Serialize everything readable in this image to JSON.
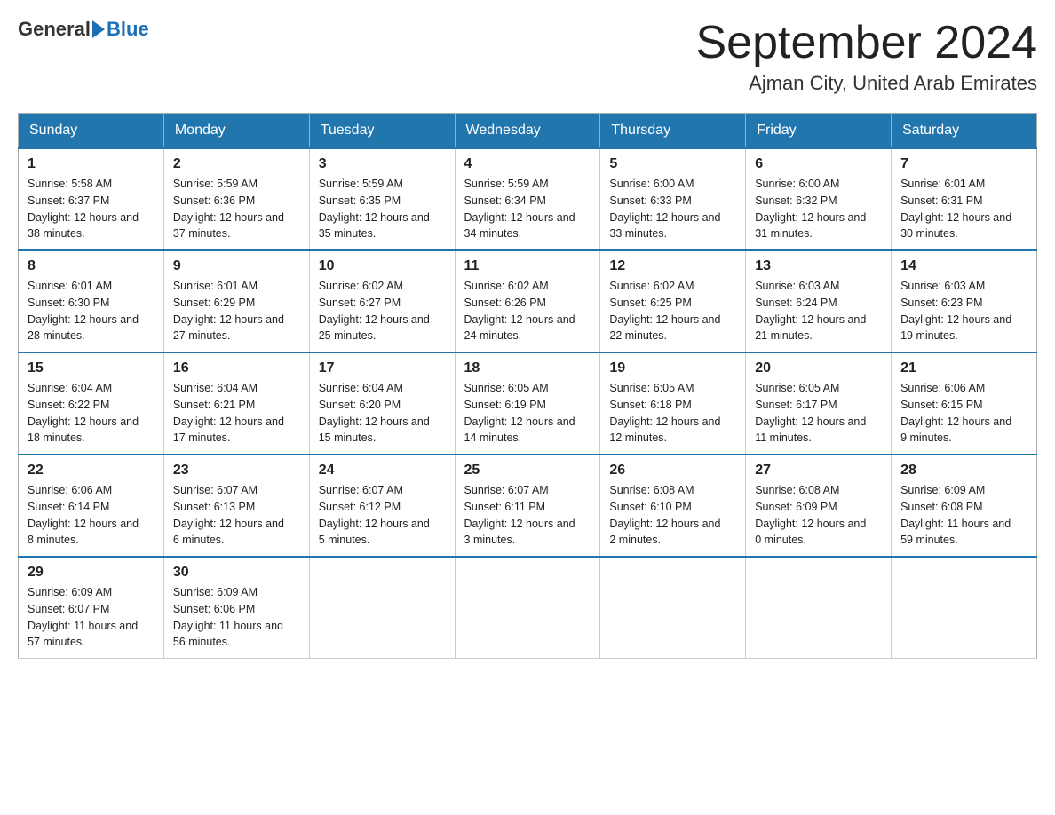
{
  "logo": {
    "general": "General",
    "blue": "Blue"
  },
  "header": {
    "month": "September 2024",
    "location": "Ajman City, United Arab Emirates"
  },
  "days_of_week": [
    "Sunday",
    "Monday",
    "Tuesday",
    "Wednesday",
    "Thursday",
    "Friday",
    "Saturday"
  ],
  "weeks": [
    [
      {
        "day": "1",
        "sunrise": "5:58 AM",
        "sunset": "6:37 PM",
        "daylight": "12 hours and 38 minutes."
      },
      {
        "day": "2",
        "sunrise": "5:59 AM",
        "sunset": "6:36 PM",
        "daylight": "12 hours and 37 minutes."
      },
      {
        "day": "3",
        "sunrise": "5:59 AM",
        "sunset": "6:35 PM",
        "daylight": "12 hours and 35 minutes."
      },
      {
        "day": "4",
        "sunrise": "5:59 AM",
        "sunset": "6:34 PM",
        "daylight": "12 hours and 34 minutes."
      },
      {
        "day": "5",
        "sunrise": "6:00 AM",
        "sunset": "6:33 PM",
        "daylight": "12 hours and 33 minutes."
      },
      {
        "day": "6",
        "sunrise": "6:00 AM",
        "sunset": "6:32 PM",
        "daylight": "12 hours and 31 minutes."
      },
      {
        "day": "7",
        "sunrise": "6:01 AM",
        "sunset": "6:31 PM",
        "daylight": "12 hours and 30 minutes."
      }
    ],
    [
      {
        "day": "8",
        "sunrise": "6:01 AM",
        "sunset": "6:30 PM",
        "daylight": "12 hours and 28 minutes."
      },
      {
        "day": "9",
        "sunrise": "6:01 AM",
        "sunset": "6:29 PM",
        "daylight": "12 hours and 27 minutes."
      },
      {
        "day": "10",
        "sunrise": "6:02 AM",
        "sunset": "6:27 PM",
        "daylight": "12 hours and 25 minutes."
      },
      {
        "day": "11",
        "sunrise": "6:02 AM",
        "sunset": "6:26 PM",
        "daylight": "12 hours and 24 minutes."
      },
      {
        "day": "12",
        "sunrise": "6:02 AM",
        "sunset": "6:25 PM",
        "daylight": "12 hours and 22 minutes."
      },
      {
        "day": "13",
        "sunrise": "6:03 AM",
        "sunset": "6:24 PM",
        "daylight": "12 hours and 21 minutes."
      },
      {
        "day": "14",
        "sunrise": "6:03 AM",
        "sunset": "6:23 PM",
        "daylight": "12 hours and 19 minutes."
      }
    ],
    [
      {
        "day": "15",
        "sunrise": "6:04 AM",
        "sunset": "6:22 PM",
        "daylight": "12 hours and 18 minutes."
      },
      {
        "day": "16",
        "sunrise": "6:04 AM",
        "sunset": "6:21 PM",
        "daylight": "12 hours and 17 minutes."
      },
      {
        "day": "17",
        "sunrise": "6:04 AM",
        "sunset": "6:20 PM",
        "daylight": "12 hours and 15 minutes."
      },
      {
        "day": "18",
        "sunrise": "6:05 AM",
        "sunset": "6:19 PM",
        "daylight": "12 hours and 14 minutes."
      },
      {
        "day": "19",
        "sunrise": "6:05 AM",
        "sunset": "6:18 PM",
        "daylight": "12 hours and 12 minutes."
      },
      {
        "day": "20",
        "sunrise": "6:05 AM",
        "sunset": "6:17 PM",
        "daylight": "12 hours and 11 minutes."
      },
      {
        "day": "21",
        "sunrise": "6:06 AM",
        "sunset": "6:15 PM",
        "daylight": "12 hours and 9 minutes."
      }
    ],
    [
      {
        "day": "22",
        "sunrise": "6:06 AM",
        "sunset": "6:14 PM",
        "daylight": "12 hours and 8 minutes."
      },
      {
        "day": "23",
        "sunrise": "6:07 AM",
        "sunset": "6:13 PM",
        "daylight": "12 hours and 6 minutes."
      },
      {
        "day": "24",
        "sunrise": "6:07 AM",
        "sunset": "6:12 PM",
        "daylight": "12 hours and 5 minutes."
      },
      {
        "day": "25",
        "sunrise": "6:07 AM",
        "sunset": "6:11 PM",
        "daylight": "12 hours and 3 minutes."
      },
      {
        "day": "26",
        "sunrise": "6:08 AM",
        "sunset": "6:10 PM",
        "daylight": "12 hours and 2 minutes."
      },
      {
        "day": "27",
        "sunrise": "6:08 AM",
        "sunset": "6:09 PM",
        "daylight": "12 hours and 0 minutes."
      },
      {
        "day": "28",
        "sunrise": "6:09 AM",
        "sunset": "6:08 PM",
        "daylight": "11 hours and 59 minutes."
      }
    ],
    [
      {
        "day": "29",
        "sunrise": "6:09 AM",
        "sunset": "6:07 PM",
        "daylight": "11 hours and 57 minutes."
      },
      {
        "day": "30",
        "sunrise": "6:09 AM",
        "sunset": "6:06 PM",
        "daylight": "11 hours and 56 minutes."
      },
      null,
      null,
      null,
      null,
      null
    ]
  ]
}
